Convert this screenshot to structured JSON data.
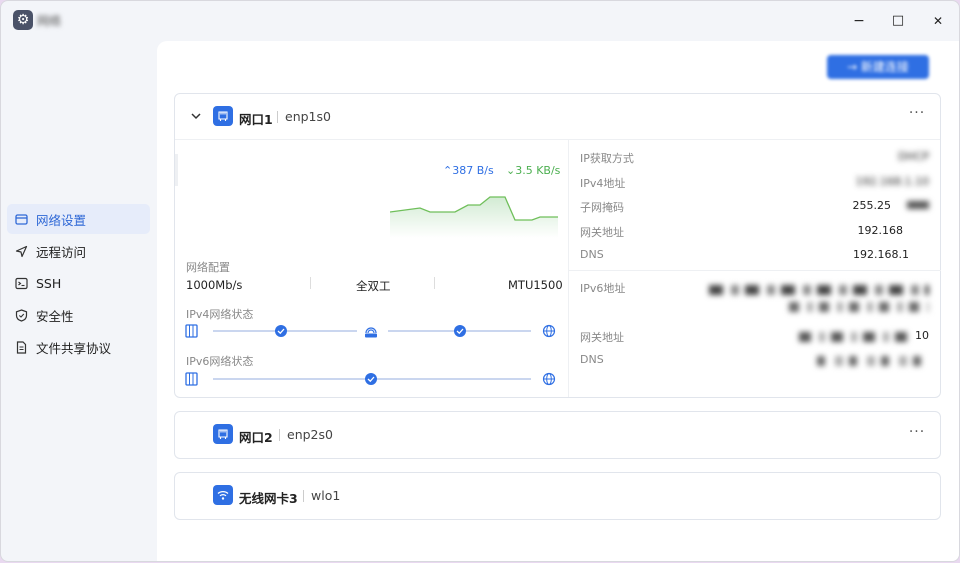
{
  "window": {
    "title": "网络",
    "controls": {
      "minimize": "−",
      "maximize": "□",
      "close": "✕"
    }
  },
  "sidebar": {
    "items": [
      {
        "label": "网络设置",
        "icon": "network-settings-icon",
        "active": true
      },
      {
        "label": "远程访问",
        "icon": "send-icon",
        "active": false
      },
      {
        "label": "SSH",
        "icon": "terminal-icon",
        "active": false
      },
      {
        "label": "安全性",
        "icon": "shield-icon",
        "active": false
      },
      {
        "label": "文件共享协议",
        "icon": "document-icon",
        "active": false
      }
    ]
  },
  "main": {
    "top_button": "→ 新建连接"
  },
  "cards": [
    {
      "title": "网口1",
      "iface": "enp1s0",
      "expanded": true,
      "upload": "387 B/s",
      "download": "3.5 KB/s",
      "config_label": "网络配置",
      "speed": "1000Mb/s",
      "duplex": "全双工",
      "mtu": "MTU1500",
      "ipv4_status_label": "IPv4网络状态",
      "ipv6_status_label": "IPv6网络状态",
      "ipv4": {
        "method_label": "IP获取方式",
        "method_value": "DHCP",
        "addr_label": "IPv4地址",
        "addr_value": "192.168.1.10",
        "mask_label": "子网掩码",
        "mask_value": "255.25",
        "gw_label": "网关地址",
        "gw_value": "192.168",
        "dns_label": "DNS",
        "dns_value": "192.168.1"
      },
      "ipv6": {
        "addr_label": "IPv6地址",
        "gw_label": "网关地址",
        "gw_suffix": "10",
        "dns_label": "DNS"
      }
    },
    {
      "title": "网口2",
      "iface": "enp2s0",
      "expanded": false
    },
    {
      "title": "无线网卡3",
      "iface": "wlo1",
      "expanded": false
    }
  ],
  "colors": {
    "accent": "#2f6fe3",
    "upload": "#2f6fe3",
    "download": "#4caf50",
    "active_bg": "#e6ecfa"
  }
}
